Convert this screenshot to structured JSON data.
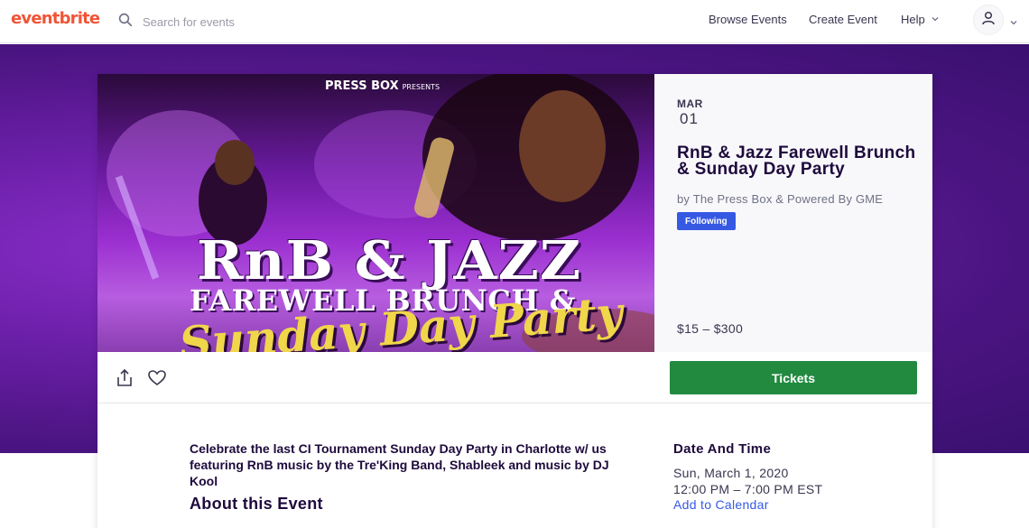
{
  "header": {
    "logo": "eventbrite",
    "search_placeholder": "Search for events",
    "nav": {
      "browse": "Browse Events",
      "create": "Create Event",
      "help": "Help"
    }
  },
  "event": {
    "hero": {
      "presenter": "PRESS BOX",
      "presents": "PRESENTS",
      "line1": "RnB & JAZZ",
      "line2": "FAREWELL BRUNCH &",
      "line3": "Sunday Day Party"
    },
    "month": "MAR",
    "day": "01",
    "title": "RnB & Jazz Farewell Brunch & Sunday Day Party",
    "organizer": "by The Press Box & Powered By GME",
    "follow_label": "Following",
    "price": "$15 – $300",
    "tickets_label": "Tickets",
    "summary": "Celebrate the last CI Tournament Sunday Day Party in Charlotte w/ us featuring RnB music by the Tre'King Band, Shableek and music by DJ Kool",
    "about_heading": "About this Event",
    "date_time": {
      "heading": "Date And Time",
      "date": "Sun, March 1, 2020",
      "time": "12:00 PM – 7:00 PM EST",
      "add_to_calendar": "Add to Calendar"
    }
  },
  "colors": {
    "brand": "#f05537",
    "tickets": "#218a3f",
    "link": "#3659e3",
    "band": "#6b1fa8"
  }
}
